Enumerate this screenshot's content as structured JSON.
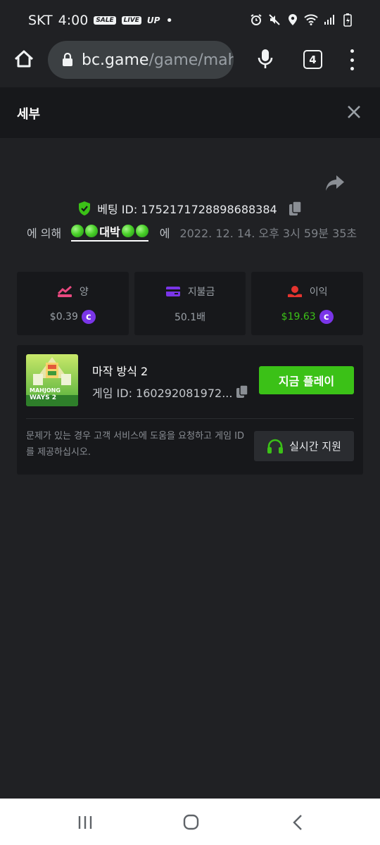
{
  "status_bar": {
    "carrier": "SKT",
    "time": "4:00",
    "badges": [
      "SALE",
      "LIVE",
      "UP"
    ],
    "icons": [
      "alarm-icon",
      "mute-icon",
      "location-icon",
      "wifi-icon",
      "signal-icon",
      "battery-icon"
    ]
  },
  "browser": {
    "url_host": "bc.game",
    "url_path": "/game/mah",
    "tab_count": "4"
  },
  "details": {
    "title": "세부"
  },
  "bet": {
    "id_label": "베팅 ID: 1752171728898688384",
    "by_label": "에 의해",
    "user_name": "대박",
    "at_label": "에",
    "date": "2022. 12. 14. 오후 3시 59분 35초"
  },
  "stats": [
    {
      "label": "양",
      "value": "$0.39",
      "icon": "bet-amount-icon",
      "color": "#e8497f"
    },
    {
      "label": "지불금",
      "value": "50.1배",
      "icon": "payout-card-icon",
      "color": "#7a35e8"
    },
    {
      "label": "이익",
      "value": "$19.63",
      "icon": "profit-icon",
      "color": "#e5342f"
    }
  ],
  "game": {
    "name": "마작 방식 2",
    "id_label": "게임 ID: 160292081972...",
    "thumb_line1": "MAHJONG",
    "thumb_line2": "WAYS 2",
    "play_label": "지금 플레이",
    "help_text": "문제가 있는 경우 고객 서비스에 도움을 요청하고 게임 ID를 제공하십시오.",
    "support_label": "실시간 지원"
  },
  "colors": {
    "accent_green": "#3bc117",
    "coin_purple": "#7a35e8",
    "background": "#202124",
    "panel": "#17181b"
  }
}
